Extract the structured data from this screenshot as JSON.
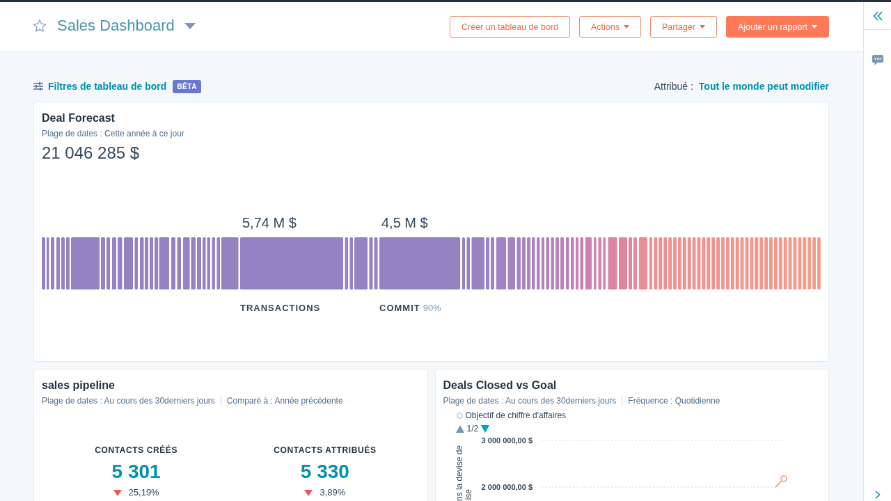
{
  "header": {
    "title": "Sales Dashboard",
    "starred": false,
    "buttons": [
      {
        "label": "Créer un tableau de bord",
        "kind": "outline",
        "dropdown": false
      },
      {
        "label": "Actions",
        "kind": "outline",
        "dropdown": true
      },
      {
        "label": "Partager",
        "kind": "outline",
        "dropdown": true
      },
      {
        "label": "Ajouter un rapport",
        "kind": "primary",
        "dropdown": true
      }
    ]
  },
  "filters": {
    "label": "Filtres de tableau de bord",
    "badge": "BÊTA"
  },
  "assignment": {
    "label": "Attribué :",
    "value": "Tout le monde peut modifier"
  },
  "deal_forecast": {
    "title": "Deal Forecast",
    "date_range": "Plage de dates : Cette année à ce jour",
    "total": "21 046 285 $",
    "highlights": [
      {
        "amount": "5,74 M $",
        "label": "TRANSACTIONS"
      },
      {
        "amount": "4,5 M $",
        "label": "COMMIT",
        "percent": "90%"
      }
    ]
  },
  "sales_pipeline": {
    "title": "sales pipeline",
    "meta": [
      "Plage de dates : Au cours des 30derniers jours",
      "Comparé à : Année précédente"
    ],
    "kpis": [
      {
        "label": "CONTACTS CRÉÉS",
        "value": "5 301",
        "change": "25,19%",
        "decreased": true
      },
      {
        "label": "CONTACTS ATTRIBUÉS",
        "value": "5 330",
        "change": "3,89%",
        "decreased": true
      }
    ]
  },
  "deals_closed": {
    "title": "Deals Closed vs Goal",
    "meta": [
      "Plage de dates : Au cours des 30derniers jours",
      "Fréquence : Quotidienne"
    ],
    "legend": {
      "label": "Objectif de chiffre d'affaires",
      "page": "1/2",
      "prev_disabled": true,
      "next_disabled": false
    },
    "chart_data": {
      "type": "line",
      "ylabel": "ns la devise de\nise",
      "categories": [
        null,
        null,
        null,
        null,
        null,
        null,
        null,
        null,
        null,
        null,
        null,
        null,
        null,
        null,
        null,
        null,
        null,
        null,
        null,
        null,
        null,
        null,
        null,
        null,
        null,
        null,
        null,
        null,
        null,
        null
      ],
      "ylim": [
        2000000,
        3000000
      ],
      "yticks": [
        {
          "value": 3000000,
          "label": "3 000 000,00 $"
        },
        {
          "value": 2000000,
          "label": "2 000 000,00 $"
        }
      ],
      "series": [
        {
          "color": "#f2a38f",
          "values": [
            null,
            null,
            null,
            null,
            null,
            null,
            null,
            null,
            null,
            null,
            null,
            null,
            null,
            null,
            null,
            null,
            null,
            null,
            null,
            null,
            null,
            null,
            null,
            null,
            null,
            null,
            null,
            null,
            2000000,
            2180000
          ]
        }
      ]
    }
  }
}
